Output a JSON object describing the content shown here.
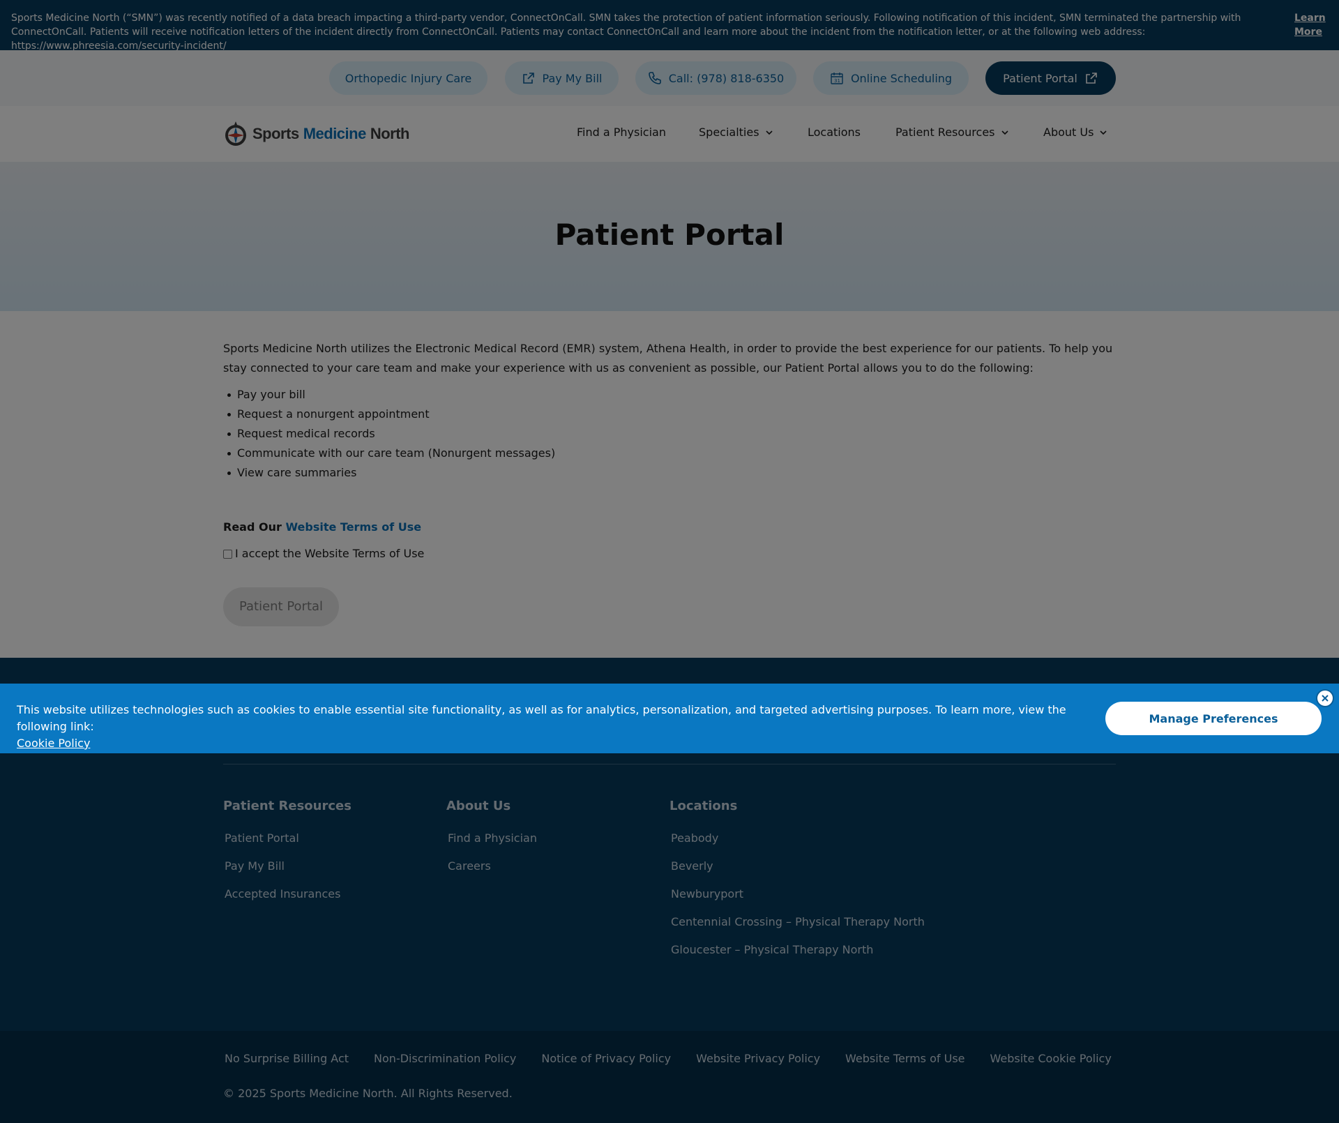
{
  "alert": {
    "text": "Sports Medicine North (“SMN”) was recently notified of a data breach impacting a third-party vendor, ConnectOnCall. SMN takes the protection of patient information seriously. Following notification of this incident, SMN terminated the partnership with ConnectOnCall. Patients will receive notification letters of the incident directly from ConnectOnCall. Patients may contact ConnectOnCall and learn more about the incident from the notification letter, or at the following web address: https://www.phreesia.com/security-incident/",
    "link_label": "Learn More"
  },
  "utility": {
    "orthopedic": "Orthopedic Injury Care",
    "pay_bill": "Pay My Bill",
    "call": "Call: (978) 818-6350",
    "scheduling": "Online Scheduling",
    "portal": "Patient Portal"
  },
  "header": {
    "logo_part1": "Sports",
    "logo_part2": "Medicine",
    "logo_part3": "North",
    "nav": {
      "find_physician": "Find a Physician",
      "specialties": "Specialties",
      "locations": "Locations",
      "patient_resources": "Patient Resources",
      "about_us": "About Us"
    }
  },
  "hero": {
    "title": "Patient Portal"
  },
  "content": {
    "intro": "Sports Medicine North utilizes the Electronic Medical Record (EMR) system, Athena Health, in order to provide the best experience for our patients. To help you stay connected to your care team and make your experience with us as convenient as possible, our Patient Portal allows you to do the following:",
    "bullets": [
      "Pay your bill",
      "Request a nonurgent appointment",
      "Request medical records",
      "Communicate with our care team (Nonurgent messages)",
      "View care summaries"
    ],
    "terms_prefix": "Read Our",
    "terms_link": "Website Terms of Use",
    "accept_label": "I accept the Website Terms of Use",
    "portal_button": "Patient Portal"
  },
  "footer": {
    "col1": {
      "heading": "Patient Resources",
      "links": [
        "Patient Portal",
        "Pay My Bill",
        "Accepted Insurances"
      ]
    },
    "col2": {
      "heading": "About Us",
      "links": [
        "Find a Physician",
        "Careers"
      ]
    },
    "col3": {
      "heading": "Locations",
      "links": [
        "Peabody",
        "Beverly",
        "Newburyport",
        "Centennial Crossing – Physical Therapy North",
        "Gloucester – Physical Therapy North"
      ]
    },
    "legal": [
      "No Surprise Billing Act",
      "Non-Discrimination Policy",
      "Notice of Privacy Policy",
      "Website Privacy Policy",
      "Website Terms of Use",
      "Website Cookie Policy"
    ],
    "copyright": "© 2025 Sports Medicine North. All Rights Reserved."
  },
  "cookie": {
    "text": "This website utilizes technologies such as cookies to enable essential site functionality, as well as for analytics, personalization, and targeted advertising purposes. To learn more, view the following link:",
    "link": "Cookie Policy",
    "manage_button": "Manage Preferences"
  },
  "colors": {
    "navy": "#063a5c",
    "accent_blue": "#0a78c2",
    "link_blue": "#0a6fb5",
    "pill_bg": "#d9ecf7"
  },
  "icons": [
    "external-link-icon",
    "phone-icon",
    "calendar-icon",
    "chevron-down-icon",
    "close-icon",
    "compass-logo-icon"
  ]
}
